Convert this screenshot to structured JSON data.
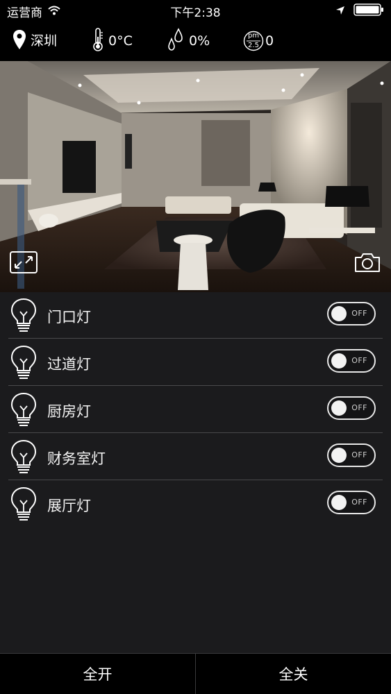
{
  "status": {
    "carrier": "运营商",
    "time": "下午2:38",
    "wifi_icon": "wifi-icon",
    "location_icon": "location-arrow-icon",
    "battery_icon": "battery-icon"
  },
  "weather": {
    "city": "深圳",
    "temperature": "0°C",
    "humidity": "0%",
    "pm_label_top": "pm",
    "pm_label_bottom": "2.5",
    "pm_value": "0"
  },
  "camera": {
    "fullscreen_icon": "fullscreen-icon",
    "snapshot_icon": "camera-icon"
  },
  "lights": [
    {
      "name": "门口灯",
      "state": "OFF"
    },
    {
      "name": "过道灯",
      "state": "OFF"
    },
    {
      "name": "厨房灯",
      "state": "OFF"
    },
    {
      "name": "财务室灯",
      "state": "OFF"
    },
    {
      "name": "展厅灯",
      "state": "OFF"
    }
  ],
  "bottom": {
    "all_on": "全开",
    "all_off": "全关"
  }
}
